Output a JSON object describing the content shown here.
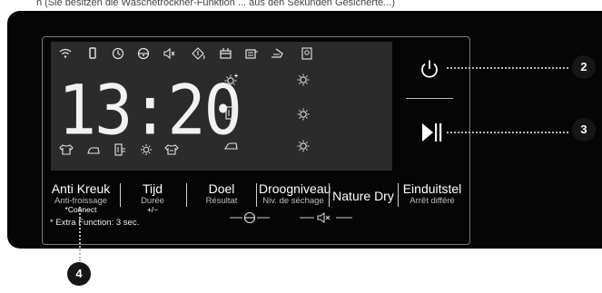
{
  "top_caption": "h (Sie besitzen die Wäschetrockner-Funktion ... aus den Sekunden Gesicherte...)",
  "clock": "13:20",
  "buttons": {
    "anti_kreuk": {
      "main": "Anti Kreuk",
      "sub": "Anti-froissage",
      "sub2": "*Connect"
    },
    "tijd": {
      "main": "Tijd",
      "sub": "Durée",
      "sub2": "+/−"
    },
    "doel": {
      "main": "Doel",
      "sub": "Résultat"
    },
    "droogniveau": {
      "main": "Droogniveau",
      "sub": "Niv. de séchage"
    },
    "nature_dry": {
      "main": "Nature Dry"
    },
    "einduitstel": {
      "main": "Einduitstel",
      "sub": "Arrêt différé"
    }
  },
  "extra_note": "* Extra Function: 3 sec.",
  "callouts": {
    "power": "2",
    "play_pause": "3",
    "anti_kreuk": "4"
  },
  "icons": {
    "top_row": [
      "wifi-icon",
      "phone-icon",
      "clock-icon",
      "child-lock-icon",
      "sound-off-icon",
      "filter-icon",
      "condenser-icon",
      "drawer-icon",
      "iron-icon",
      "tag-icon"
    ],
    "bottom_row": [
      "shirt-icon",
      "iron-low-icon",
      "cabinet-icon",
      "sun-icon",
      "shirt-dry-icon"
    ],
    "sun_levels": [
      "sun-plus-icon",
      "sun-icon",
      "sun-icon",
      "sun-icon",
      "sun-icon"
    ]
  },
  "colors": {
    "panel": "#050505",
    "lcd": "#2b2b2b",
    "callout": "#161616"
  }
}
